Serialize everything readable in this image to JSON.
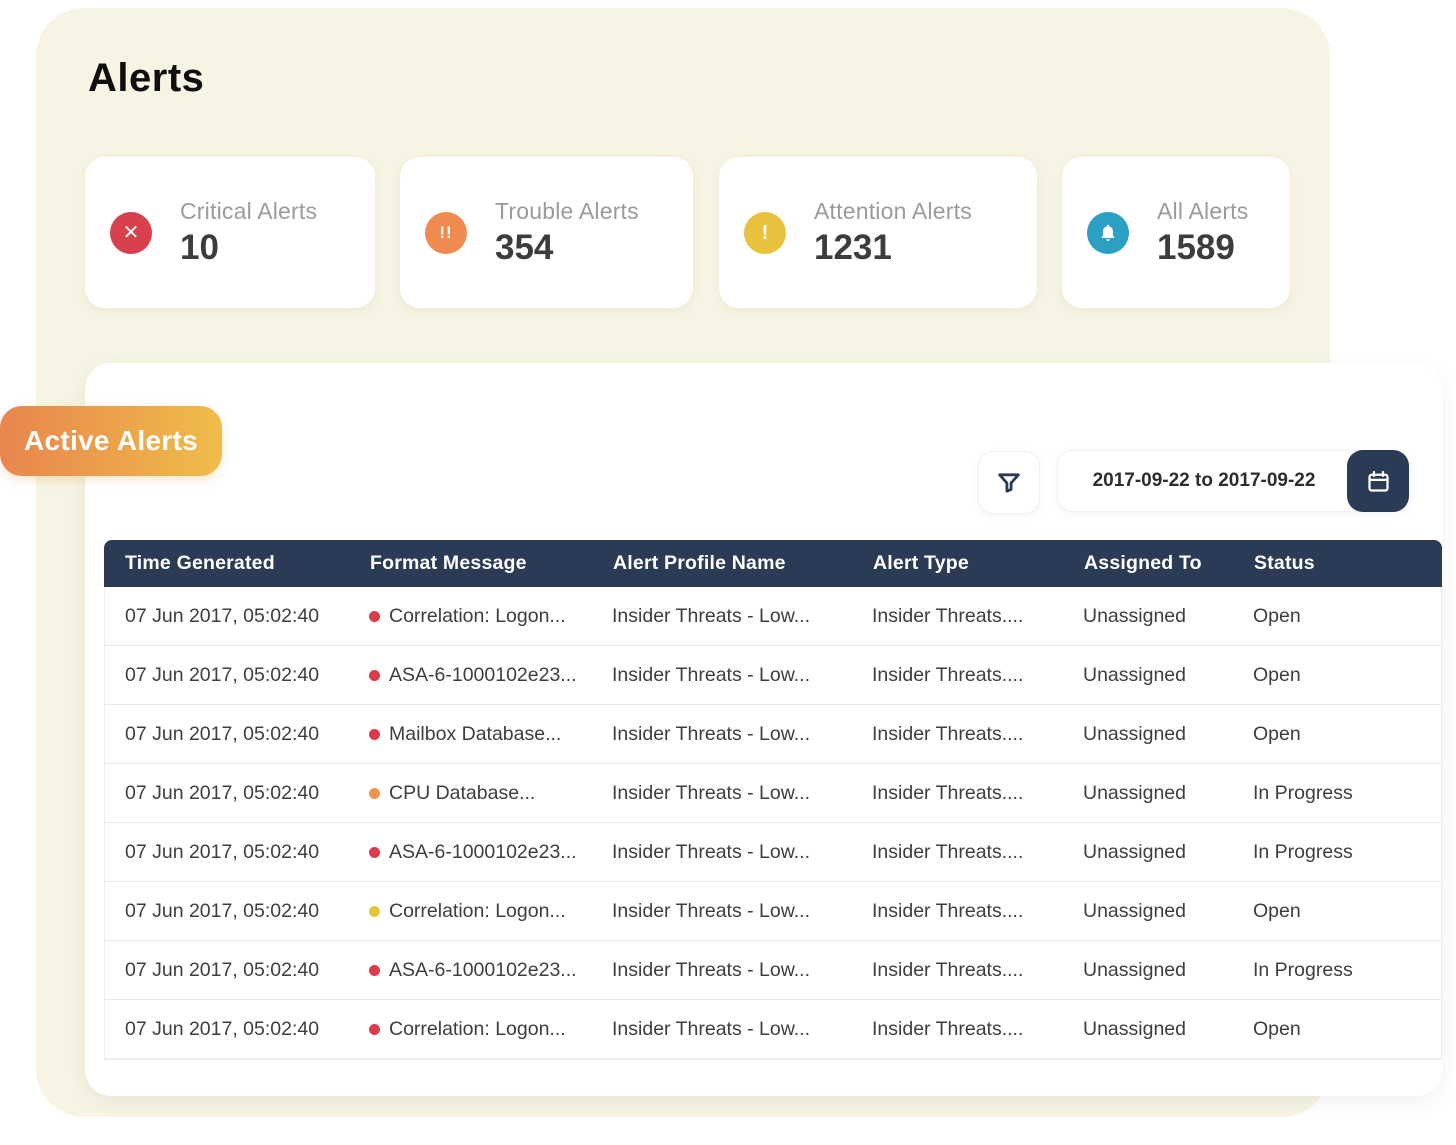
{
  "page": {
    "title": "Alerts",
    "background_color": "#F7F4E3",
    "accent_navy": "#2B3A55"
  },
  "summary_cards": [
    {
      "label": "Critical Alerts",
      "value": "10",
      "icon": "x-circle-icon",
      "glyph": "✕",
      "color": "#D8404E"
    },
    {
      "label": "Trouble Alerts",
      "value": "354",
      "icon": "double-exclamation-icon",
      "glyph": "!!",
      "color": "#EF8A51"
    },
    {
      "label": "Attention Alerts",
      "value": "1231",
      "icon": "exclamation-icon",
      "glyph": "!",
      "color": "#E9C23D"
    },
    {
      "label": "All Alerts",
      "value": "1589",
      "icon": "bell-icon",
      "glyph": "",
      "color": "#2BA0C2"
    }
  ],
  "panel": {
    "badge_label": "Active Alerts",
    "badge_gradient": [
      "#E8854E",
      "#EFBD49"
    ],
    "filter_icon": "funnel-icon",
    "date_range": "2017-09-22 to 2017-09-22",
    "calendar_icon": "calendar-icon",
    "table": {
      "columns": [
        "Time Generated",
        "Format Message",
        "Alert Profile Name",
        "Alert Type",
        "Assigned To",
        "Status"
      ],
      "severity_colors": {
        "red": "#DB3B4B",
        "orange": "#F0934E",
        "yellow": "#E8C33C"
      },
      "rows": [
        {
          "time": "07 Jun 2017, 05:02:40",
          "severity": "red",
          "severity_color": "#DB3B4B",
          "message": "Correlation: Logon...",
          "profile": "Insider Threats - Low...",
          "type": "Insider Threats....",
          "assigned": "Unassigned",
          "status": "Open"
        },
        {
          "time": "07 Jun 2017, 05:02:40",
          "severity": "red",
          "severity_color": "#DB3B4B",
          "message": "ASA-6-1000102e23...",
          "profile": "Insider Threats - Low...",
          "type": "Insider Threats....",
          "assigned": "Unassigned",
          "status": "Open"
        },
        {
          "time": "07 Jun 2017, 05:02:40",
          "severity": "red",
          "severity_color": "#DB3B4B",
          "message": "Mailbox Database...",
          "profile": "Insider Threats - Low...",
          "type": "Insider Threats....",
          "assigned": "Unassigned",
          "status": "Open"
        },
        {
          "time": "07 Jun 2017, 05:02:40",
          "severity": "orange",
          "severity_color": "#F0934E",
          "message": "CPU Database...",
          "profile": "Insider Threats - Low...",
          "type": "Insider Threats....",
          "assigned": "Unassigned",
          "status": "In Progress"
        },
        {
          "time": "07 Jun 2017, 05:02:40",
          "severity": "red",
          "severity_color": "#DB3B4B",
          "message": "ASA-6-1000102e23...",
          "profile": "Insider Threats - Low...",
          "type": "Insider Threats....",
          "assigned": "Unassigned",
          "status": "In Progress"
        },
        {
          "time": "07 Jun 2017, 05:02:40",
          "severity": "yellow",
          "severity_color": "#E8C33C",
          "message": "Correlation: Logon...",
          "profile": "Insider Threats - Low...",
          "type": "Insider Threats....",
          "assigned": "Unassigned",
          "status": "Open"
        },
        {
          "time": "07 Jun 2017, 05:02:40",
          "severity": "red",
          "severity_color": "#DB3B4B",
          "message": "ASA-6-1000102e23...",
          "profile": "Insider Threats - Low...",
          "type": "Insider Threats....",
          "assigned": "Unassigned",
          "status": "In Progress"
        },
        {
          "time": "07 Jun 2017, 05:02:40",
          "severity": "red",
          "severity_color": "#DB3B4B",
          "message": "Correlation: Logon...",
          "profile": "Insider Threats - Low...",
          "type": "Insider Threats....",
          "assigned": "Unassigned",
          "status": "Open"
        }
      ]
    }
  }
}
